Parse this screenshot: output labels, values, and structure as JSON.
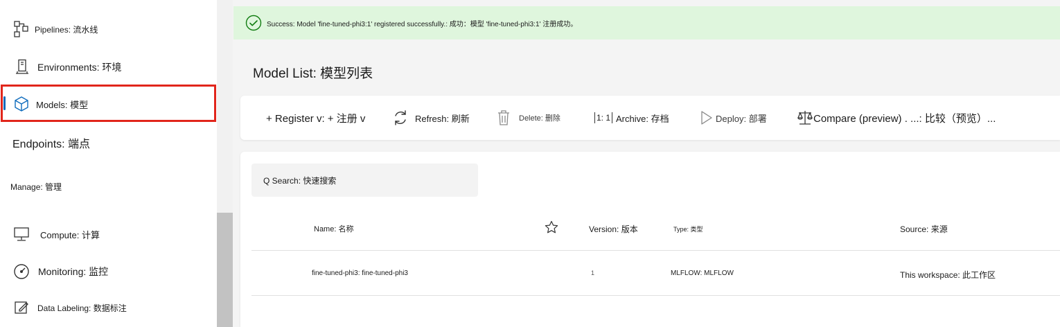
{
  "sidebar": {
    "items": [
      {
        "label": "Pipelines: 流水线",
        "icon": "pipeline-icon"
      },
      {
        "label": "Environments: 环境",
        "icon": "environment-icon"
      },
      {
        "label": "Models: 模型",
        "icon": "cube-icon"
      },
      {
        "label": "Endpoints: 端点",
        "icon": "endpoint-icon"
      },
      {
        "label": "Compute: 计算",
        "icon": "monitor-icon"
      },
      {
        "label": "Monitoring: 监控",
        "icon": "gauge-icon"
      },
      {
        "label": "Data Labeling: 数据标注",
        "icon": "edit-icon"
      }
    ],
    "manage_heading": "Manage: 管理"
  },
  "banner": {
    "message": "Success: Model 'fine-tuned-phi3:1' registered successfully.: 成功：模型 'fine-tuned-phi3:1' 注册成功。"
  },
  "page": {
    "title": "Model List: 模型列表"
  },
  "toolbar": {
    "register": "+ Register v: + 注册 v",
    "refresh": "Refresh: 刷新",
    "delete": "Delete: 删除",
    "archive_icon": "1: 1",
    "archive": "Archive: 存档",
    "deploy": "Deploy: 部署",
    "compare": "Compare (preview) . ...: 比较（预览）..."
  },
  "search": {
    "text": "Q Search: 快速搜索"
  },
  "table": {
    "columns": {
      "name": "Name: 名称",
      "version": "Version: 版本",
      "type": "Type: 类型",
      "source": "Source: 来源"
    },
    "rows": [
      {
        "name": "fine-tuned-phi3: fine-tuned-phi3",
        "version": "1",
        "type": "MLFLOW: MLFLOW",
        "source": "This workspace: 此工作区"
      }
    ]
  },
  "colors": {
    "success_bg": "#dff6dd",
    "success_icon": "#107c10",
    "active_highlight": "#e1251b",
    "accent": "#0f6cbd"
  }
}
